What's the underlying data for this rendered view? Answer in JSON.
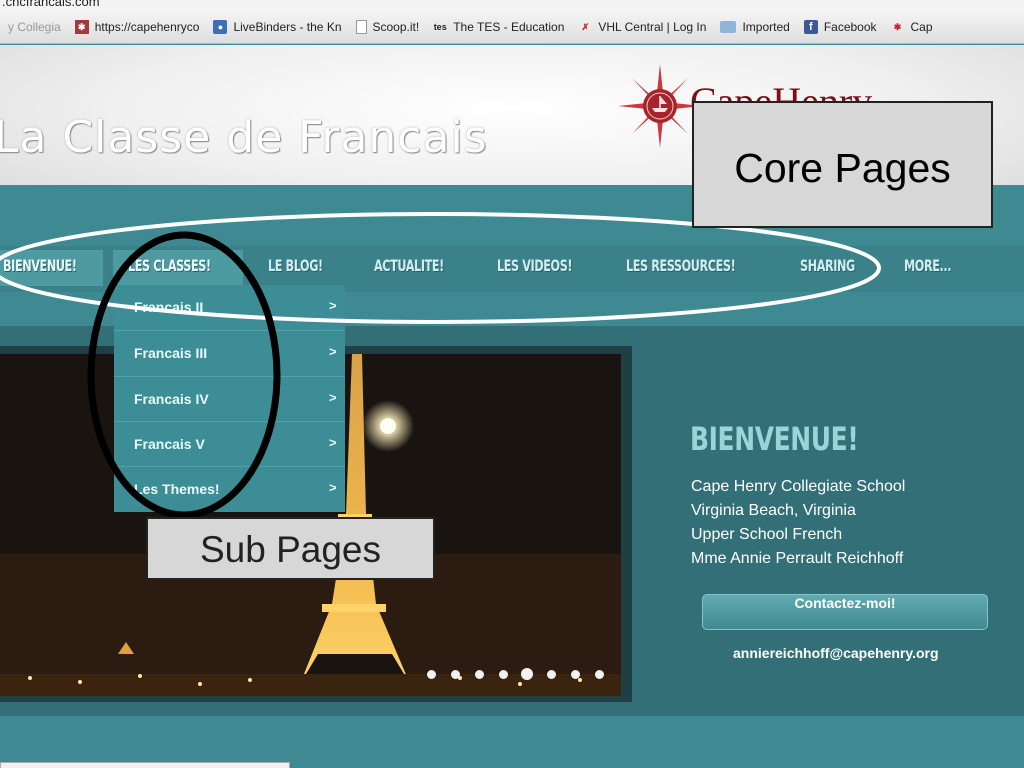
{
  "browser": {
    "url_fragment": ".chcfrancais.com",
    "bookmarks": [
      {
        "label": "y Collegia",
        "icon": "page-icon"
      },
      {
        "label": "https://capehenryco",
        "icon": "favicon-icon"
      },
      {
        "label": "LiveBinders - the Kn",
        "icon": "livebinders-icon"
      },
      {
        "label": "Scoop.it!",
        "icon": "page-icon"
      },
      {
        "label": "The TES - Education",
        "icon": "tes-icon"
      },
      {
        "label": "VHL Central | Log In",
        "icon": "vhl-icon"
      },
      {
        "label": "Imported",
        "icon": "folder-icon"
      },
      {
        "label": "Facebook",
        "icon": "facebook-icon"
      },
      {
        "label": "Cap",
        "icon": "capehenry-icon"
      }
    ],
    "status_text": ""
  },
  "header": {
    "site_title": "La Classe de Francais",
    "logo_text": "CapeHenry"
  },
  "nav": {
    "items": [
      {
        "label": "BIENVENUE!"
      },
      {
        "label": "LES CLASSES!"
      },
      {
        "label": "LE BLOG!"
      },
      {
        "label": "ACTUALITE!"
      },
      {
        "label": "LES VIDEOS!"
      },
      {
        "label": "LES RESSOURCES!"
      },
      {
        "label": "SHARING"
      },
      {
        "label": "MORE..."
      }
    ]
  },
  "dropdown": {
    "items": [
      {
        "label": "Francais II",
        "arrow": ">"
      },
      {
        "label": "Francais III",
        "arrow": ">"
      },
      {
        "label": "Francais IV",
        "arrow": ">"
      },
      {
        "label": "Francais V",
        "arrow": ">"
      },
      {
        "label": "Les Themes!",
        "arrow": ">"
      }
    ]
  },
  "annotations": {
    "core_label": "Core Pages",
    "sub_label": "Sub Pages"
  },
  "welcome": {
    "title": "BIENVENUE!",
    "lines": [
      "Cape Henry Collegiate School",
      "Virginia Beach,  Virginia",
      "Upper School French",
      "Mme Annie Perrault Reichhoff"
    ],
    "contact_label": "Contactez-moi!",
    "email": "anniereichhoff@capehenry.org"
  },
  "slideshow": {
    "dot_count": 8,
    "active_dot": 4
  },
  "colors": {
    "teal": "#3f8a92",
    "nav_text": "#cfeef0",
    "welcome_title": "#9ad4d9",
    "logo_red": "#7a1118"
  }
}
